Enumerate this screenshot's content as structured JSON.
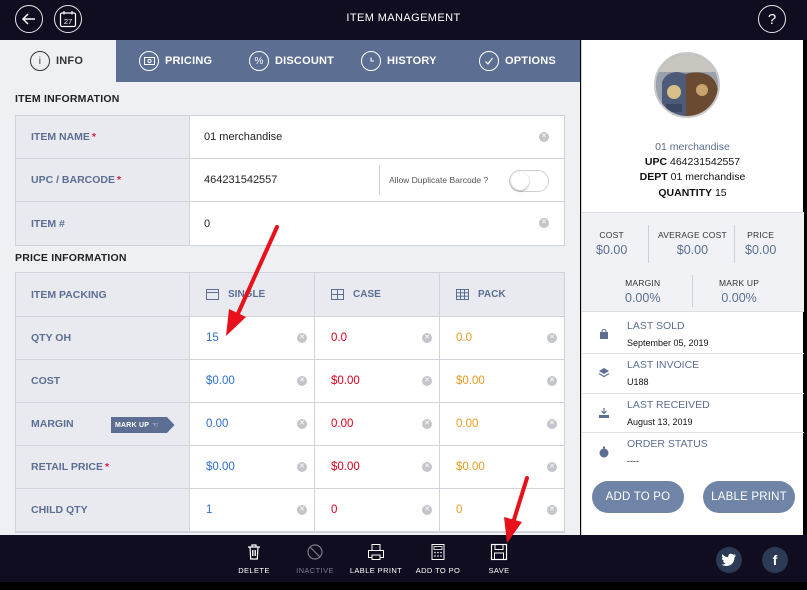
{
  "header": {
    "title": "ITEM MANAGEMENT",
    "calendar_day": "27",
    "help": "?"
  },
  "tabs": [
    {
      "label": "INFO",
      "icon": "info-icon",
      "active": true
    },
    {
      "label": "PRICING",
      "icon": "money-icon"
    },
    {
      "label": "DISCOUNT",
      "icon": "percent-icon"
    },
    {
      "label": "HISTORY",
      "icon": "clock-icon"
    },
    {
      "label": "OPTIONS",
      "icon": "check-icon"
    }
  ],
  "item_info": {
    "section_title": "ITEM INFORMATION",
    "name_label": "ITEM NAME",
    "name_value": "01 merchandise",
    "upc_label": "UPC / BARCODE",
    "upc_value": "464231542557",
    "allow_duplicate_label": "Allow Duplicate Barcode ?",
    "item_no_label": "ITEM #",
    "item_no_value": "0",
    "required_mark": "*"
  },
  "price_info": {
    "section_title": "PRICE INFORMATION",
    "packing_label": "ITEM PACKING",
    "columns": [
      "SINGLE",
      "CASE",
      "PACK"
    ],
    "markup_badge": "MARK UP",
    "rows": [
      {
        "label": "QTY OH",
        "required": false,
        "values": [
          "15",
          "0.0",
          "0.0"
        ]
      },
      {
        "label": "COST",
        "required": false,
        "values": [
          "$0.00",
          "$0.00",
          "$0.00"
        ]
      },
      {
        "label": "MARGIN",
        "required": false,
        "values": [
          "0.00",
          "0.00",
          "0.00"
        ]
      },
      {
        "label": "RETAIL PRICE",
        "required": true,
        "values": [
          "$0.00",
          "$0.00",
          "$0.00"
        ]
      },
      {
        "label": "CHILD QTY",
        "required": false,
        "values": [
          "1",
          "0",
          "0"
        ]
      }
    ]
  },
  "side": {
    "product_name": "01 merchandise",
    "upc_label": "UPC",
    "upc_value": "464231542557",
    "dept_label": "DEPT",
    "dept_value": "01 merchandise",
    "quantity_label": "QUANTITY",
    "quantity_value": "15",
    "stats": {
      "cost_label": "COST",
      "cost_value": "$0.00",
      "avg_cost_label": "AVERAGE COST",
      "avg_cost_value": "$0.00",
      "price_label": "PRICE",
      "price_value": "$0.00",
      "margin_label": "MARGIN",
      "margin_value": "0.00%",
      "markup_label": "MARK UP",
      "markup_value": "0.00%"
    },
    "events": [
      {
        "title": "LAST SOLD",
        "value": "September 05, 2019",
        "icon": "bag-icon"
      },
      {
        "title": "LAST INVOICE",
        "value": "U188",
        "icon": "stack-icon"
      },
      {
        "title": "LAST RECEIVED",
        "value": "August 13, 2019",
        "icon": "tray-icon"
      },
      {
        "title": "ORDER STATUS",
        "value": "----",
        "icon": "stopwatch-icon"
      }
    ],
    "add_to_po": "ADD TO PO",
    "lable_print": "LABLE PRINT"
  },
  "toolbar": {
    "delete": "DELETE",
    "inactive": "INACTIVE",
    "lable_print": "LABLE PRINT",
    "add_to_po": "ADD TO PO",
    "save": "SAVE"
  },
  "social": {
    "twitter": "twitter-icon",
    "facebook": "f"
  },
  "colors": {
    "accent": "#5c6e91",
    "single": "#2d6fd0",
    "case": "#d9001b",
    "pack": "#e89a1e",
    "bar": "#0f0d1f",
    "annotation": "#e8101a"
  }
}
